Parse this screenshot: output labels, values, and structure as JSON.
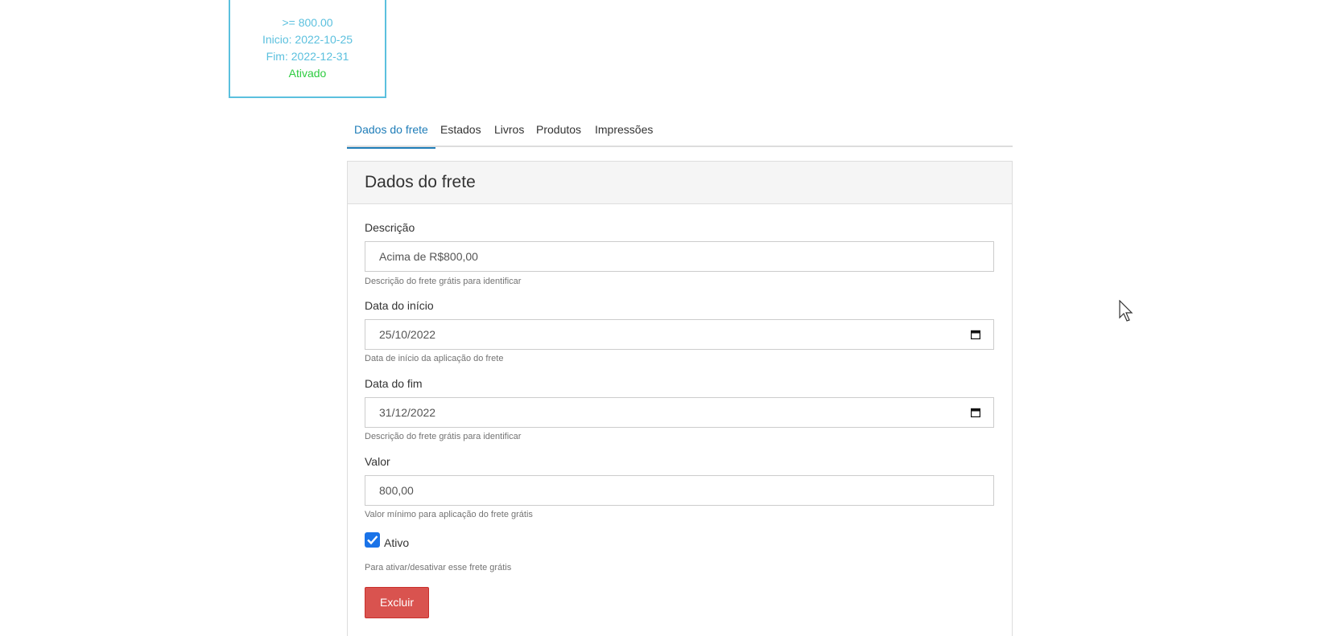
{
  "summary_card": {
    "threshold": ">= 800.00",
    "start": "Inicio: 2022-10-25",
    "end": "Fim: 2022-12-31",
    "status": "Ativado"
  },
  "tabs": [
    {
      "label": "Dados do frete",
      "active": true
    },
    {
      "label": "Estados",
      "active": false
    },
    {
      "label": "Livros",
      "active": false
    },
    {
      "label": "Produtos",
      "active": false
    },
    {
      "label": "Impressões",
      "active": false
    }
  ],
  "panel": {
    "title": "Dados do frete",
    "fields": {
      "descricao": {
        "label": "Descrição",
        "value": "Acima de R$800,00",
        "help": "Descrição do frete grátis para identificar"
      },
      "data_inicio": {
        "label": "Data do início",
        "value": "25/10/2022",
        "help": "Data de início da aplicação do frete"
      },
      "data_fim": {
        "label": "Data do fim",
        "value": "31/12/2022",
        "help": "Descrição do frete grátis para identificar"
      },
      "valor": {
        "label": "Valor",
        "value": "800,00",
        "help": "Valor mínimo para aplicação do frete grátis"
      }
    },
    "ativo": {
      "label": "Ativo",
      "checked": true,
      "help": "Para ativar/desativar esse frete grátis"
    },
    "delete_label": "Excluir"
  },
  "colors": {
    "accent": "#1f7db8",
    "info": "#5bc0de",
    "success": "#2ecc40",
    "danger": "#d9534f",
    "checkbox": "#1a73e8"
  },
  "icons": {
    "calendar": "calendar-icon",
    "checkmark": "checkmark-icon",
    "cursor": "mouse-cursor-icon"
  }
}
